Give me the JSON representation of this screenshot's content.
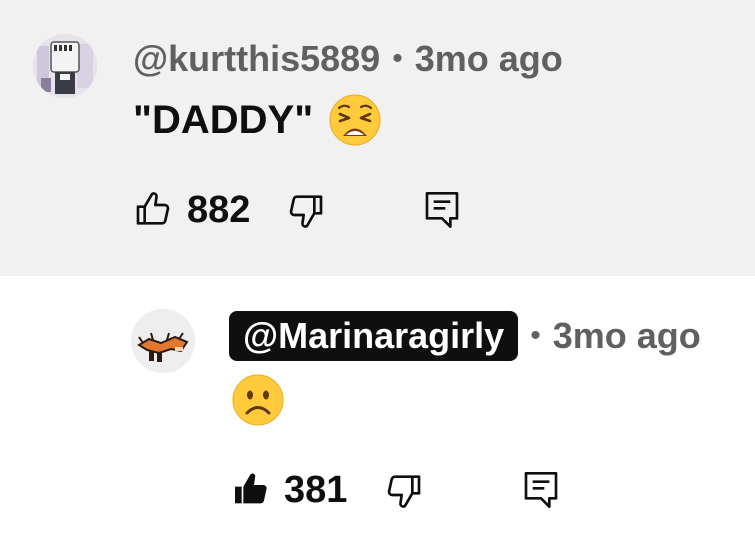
{
  "comments": [
    {
      "author": "@kurtthis5889",
      "separator": "•",
      "timestamp": "3mo ago",
      "text": "\"DADDY\"",
      "emoji": "weary-face-emoji",
      "likes": "882",
      "liked": false,
      "icons": [
        "thumbs-up-outline-icon",
        "thumbs-down-outline-icon",
        "reply-comment-icon"
      ]
    },
    {
      "author": "@Marinaragirly",
      "separator": "•",
      "timestamp": "3mo ago",
      "text": "",
      "emoji": "frowning-face-emoji",
      "likes": "381",
      "liked": true,
      "icons": [
        "thumbs-up-filled-icon",
        "thumbs-down-outline-icon",
        "reply-comment-icon"
      ]
    }
  ],
  "colors": {
    "highlighted_background": "#f1f1f1",
    "secondary_text": "#606060",
    "primary_text": "#0f0f0f",
    "mention_chip_bg": "#0f0f0f"
  }
}
